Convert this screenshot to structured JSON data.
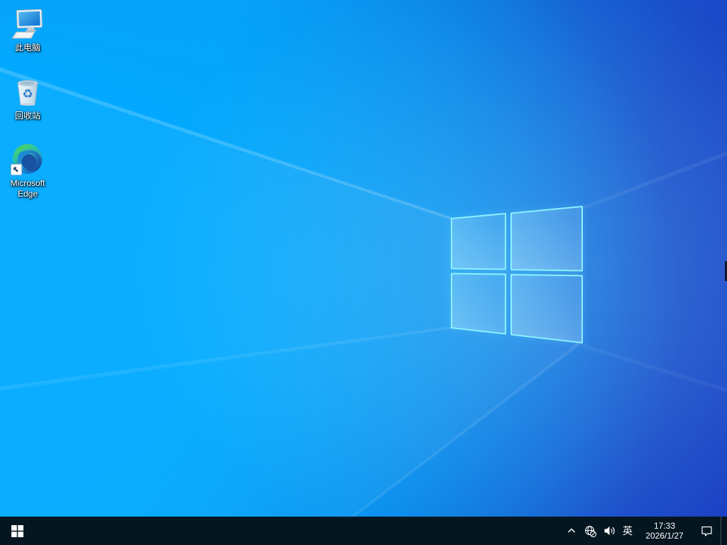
{
  "desktop": {
    "icons": [
      {
        "label": "此电脑"
      },
      {
        "label": "回收站"
      },
      {
        "label_line1": "Microsoft",
        "label_line2": "Edge"
      }
    ]
  },
  "taskbar": {
    "ime_indicator": "英",
    "clock_time": "17:33",
    "clock_date": "2026/1/27"
  },
  "icon_glyphs": {
    "desktop": [
      "this-pc-icon",
      "recycle-bin-icon",
      "edge-icon",
      "shortcut-arrow-icon"
    ],
    "taskbar": [
      "windows-logo-icon",
      "chevron-up-icon",
      "globe-no-internet-icon",
      "speaker-icon",
      "action-center-icon"
    ],
    "recycle_symbol": "♻"
  },
  "colors": {
    "taskbar_bg": "#041620",
    "wallpaper_left": "#00aaff",
    "wallpaper_right": "#1b41c4",
    "wallpaper_topleft": "#1f8de9",
    "logo_stroke": "#8df0ff",
    "label_text": "#ffffff"
  }
}
